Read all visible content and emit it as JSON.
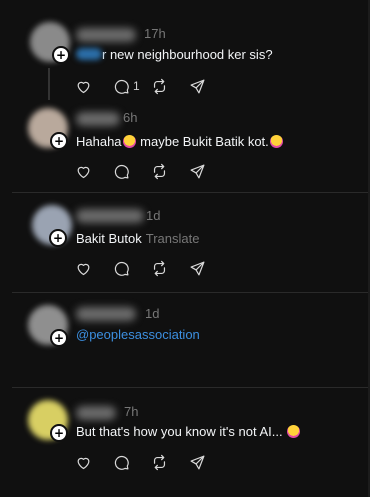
{
  "posts": [
    {
      "time": "17h",
      "text_prefix": "",
      "text": "r new neighbourhood ker sis?",
      "reply_count": "1",
      "avatar_color": "#8a8a8a"
    },
    {
      "time": "6h",
      "text_a": "Hahaha",
      "text_b": " maybe Bukit Batik kot.",
      "avatar_color": "#b9a99c"
    },
    {
      "time": "1d",
      "text": "Bakit Butok",
      "translate_label": "Translate",
      "avatar_color": "#9aa3b2"
    },
    {
      "time": "1d",
      "mention": "@peoplesassociation",
      "avatar_color": "#8f8f8f"
    },
    {
      "time": "7h",
      "text": "But that's how you know it's not AI... ",
      "avatar_color": "#d8cf63"
    }
  ],
  "icons": {
    "like": "heart-icon",
    "reply": "comment-icon",
    "repost": "repost-icon",
    "share": "send-icon",
    "follow": "plus-icon"
  },
  "colors": {
    "background": "#101010",
    "text": "#f3f5f7",
    "muted": "#777777",
    "link": "#3c8fe0"
  }
}
